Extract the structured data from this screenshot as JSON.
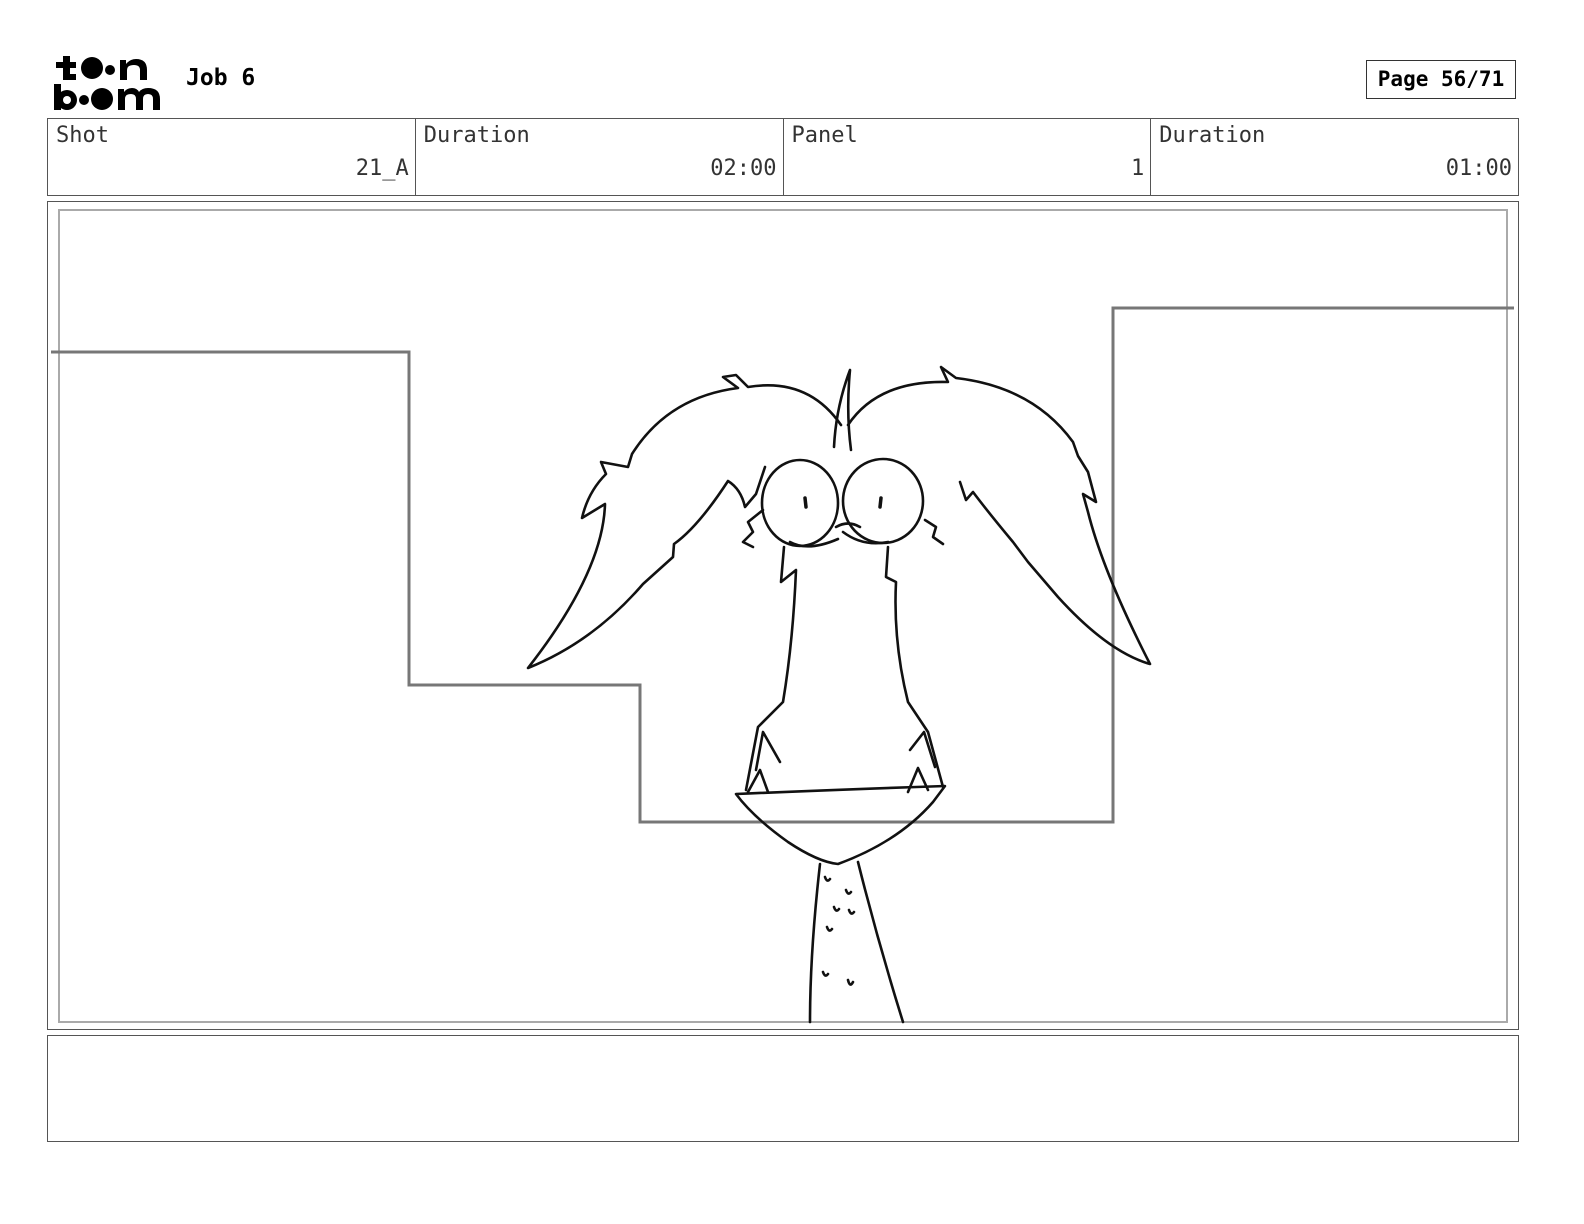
{
  "header": {
    "logo_text": "toon boom",
    "job_title": "Job 6",
    "page_label": "Page 56/71"
  },
  "info": {
    "shot_label": "Shot",
    "shot_value": "21_A",
    "shot_duration_label": "Duration",
    "shot_duration_value": "02:00",
    "panel_label": "Panel",
    "panel_value": "1",
    "panel_duration_label": "Duration",
    "panel_duration_value": "01:00"
  },
  "panel": {
    "image_icon": "storyboard-sketch-creature-icon"
  },
  "notes": {
    "text": ""
  }
}
